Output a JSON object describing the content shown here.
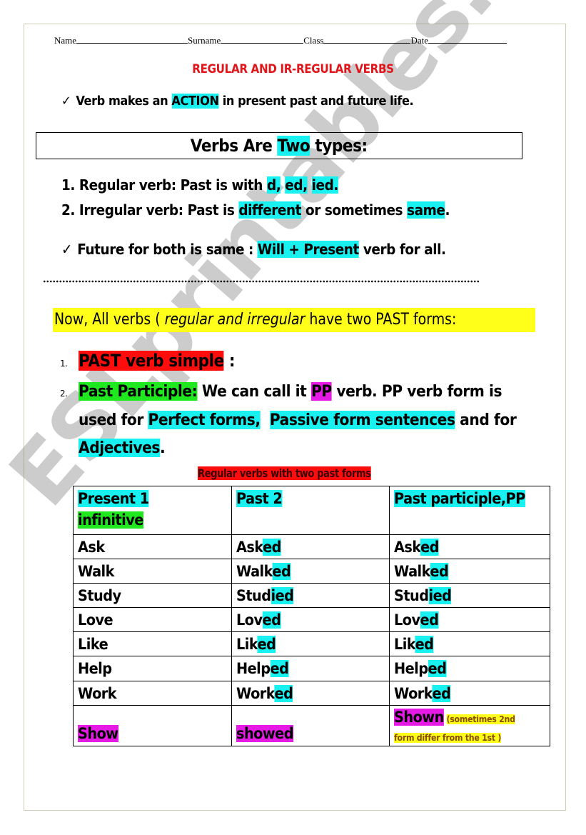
{
  "header": {
    "fields": [
      {
        "label": "Name",
        "value": ""
      },
      {
        "label": "Surname",
        "value": ""
      },
      {
        "label": "Class",
        "value": ""
      },
      {
        "label": "Date",
        "value": ""
      }
    ]
  },
  "title": "REGULAR AND IR-REGULAR VERBS",
  "intro": {
    "check_icon": "checkmark",
    "before": "Verb makes an ",
    "highlight": "ACTION",
    "after": " in present past and future life."
  },
  "types_box": {
    "before": "Verbs Are ",
    "highlight": "Two",
    "after": " types:"
  },
  "types": [
    {
      "num": "1.",
      "text": " Regular verb: Past is with ",
      "highlights": [
        "d,",
        "ed,",
        "ied."
      ]
    },
    {
      "num": "2.",
      "text": " Irregular verb: Past is ",
      "hl1": "different",
      "mid": " or sometimes ",
      "hl2": "same",
      "end": "."
    }
  ],
  "future": {
    "check_icon": "checkmark",
    "before": "Future for both is same : ",
    "highlight": "Will + Present",
    "after": " verb for all."
  },
  "separator": "dotted-line",
  "now_line": {
    "before": "Now, All verbs ( ",
    "italic": "regular and irregular",
    "after": " have two PAST forms:"
  },
  "forms": [
    {
      "num": "1.",
      "label": "PAST verb simple",
      "after": " :"
    },
    {
      "num": "2.",
      "label": "Past Participle:",
      "text1": " We can call it ",
      "pp": "PP",
      "text2": " verb. PP verb form  is",
      "line2_before": "used for ",
      "hl_perfect": "Perfect forms,",
      "line2_mid": "  ",
      "hl_passive": "Passive form sentences",
      "line2_after": " and for",
      "hl_adjectives": "Adjectives",
      "line3_after": "."
    }
  ],
  "table": {
    "caption": "Regular verbs with two past forms",
    "headers": [
      {
        "line1": "Present 1",
        "line2": "infinitive"
      },
      {
        "line1": "Past 2"
      },
      {
        "line1": "Past participle,PP"
      }
    ],
    "rows": [
      {
        "present": "Ask",
        "past_stem": "Ask",
        "past_suffix": "ed",
        "pp_stem": "Ask",
        "pp_suffix": "ed"
      },
      {
        "present": "Walk",
        "past_stem": "Walk",
        "past_suffix": "ed",
        "pp_stem": "Walk",
        "pp_suffix": "ed"
      },
      {
        "present": "Study",
        "past_stem": "Stud",
        "past_suffix": "ied",
        "pp_stem": "Stud",
        "pp_suffix": "ied"
      },
      {
        "present": "Love",
        "past_stem": "Lov",
        "past_suffix": "ed",
        "pp_stem": "Lov",
        "pp_suffix": "ed"
      },
      {
        "present": "Like",
        "past_stem": "Lik",
        "past_suffix": "ed",
        "pp_stem": "Lik",
        "pp_suffix": "ed"
      },
      {
        "present": "Help",
        "past_stem": "Help",
        "past_suffix": "ed",
        "pp_stem": "Help",
        "pp_suffix": "ed"
      },
      {
        "present": "Work",
        "past_stem": "Work",
        "past_suffix": "ed",
        "pp_stem": "Work",
        "pp_suffix": "ed"
      }
    ],
    "last_row": {
      "present": "Show",
      "past": "showed",
      "pp": "Shown",
      "note_line1": "(sometimes 2nd",
      "note_line2": "form differ from the 1st )"
    }
  },
  "watermark": "ESLprintables.com",
  "colors": {
    "title_red": "#e0161b",
    "cyan": "#19f0f0",
    "green": "#1fe81f",
    "red": "#ff0d0d",
    "magenta": "#e51be5",
    "yellow": "#ffff1a"
  }
}
